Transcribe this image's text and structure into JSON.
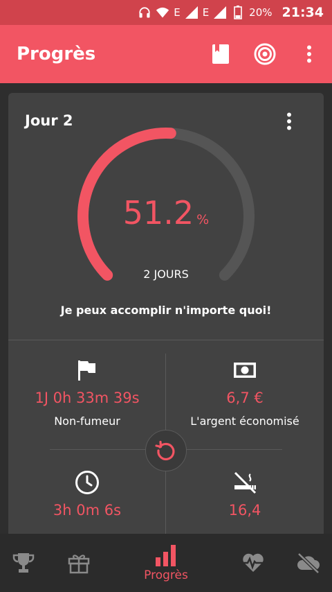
{
  "status_bar": {
    "battery": "20%",
    "time": "21:34",
    "net1": "E",
    "net2": "E"
  },
  "app_bar": {
    "title": "Progrès",
    "actions": [
      "book-icon",
      "target-icon",
      "overflow-menu-icon"
    ]
  },
  "progress_card": {
    "day_title": "Jour 2",
    "percent": "51.2",
    "percent_value": 51.2,
    "percent_unit": "%",
    "days_label": "2 JOURS",
    "motto": "Je peux accomplir n'importe quoi!"
  },
  "stats": [
    {
      "icon": "flag-icon",
      "value": "1J 0h 33m 39s",
      "label": "Non-fumeur"
    },
    {
      "icon": "money-icon",
      "value": "6,7 €",
      "label": "L'argent économisé"
    },
    {
      "icon": "clock-icon",
      "value": "3h 0m 6s",
      "label": ""
    },
    {
      "icon": "no-smoking-icon",
      "value": "16,4",
      "label": ""
    }
  ],
  "bottom_nav": {
    "items": [
      {
        "icon": "trophy-icon",
        "label": ""
      },
      {
        "icon": "gift-icon",
        "label": ""
      },
      {
        "icon": "bar-chart-icon",
        "label": "Progrès"
      },
      {
        "icon": "heartbeat-icon",
        "label": ""
      },
      {
        "icon": "cloud-off-icon",
        "label": ""
      }
    ]
  },
  "colors": {
    "accent": "#f25563",
    "status_bar": "#d0434c",
    "card": "#424242",
    "background": "#2e2e2e",
    "track": "#555555"
  }
}
